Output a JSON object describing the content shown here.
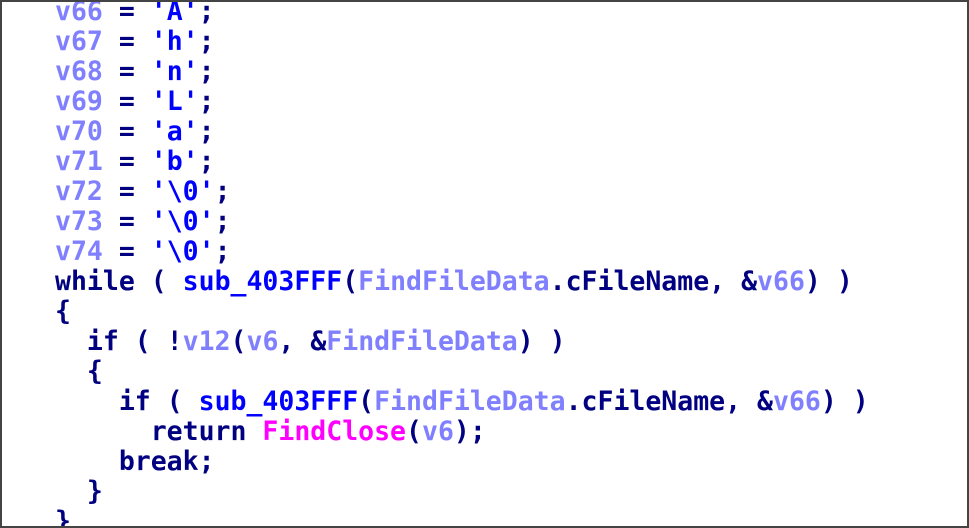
{
  "colors": {
    "keyword": "#000080",
    "punctuation": "#000080",
    "variable": "#8080ff",
    "string": "#0000ff",
    "function": "#0000ff",
    "import": "#ff00ff"
  },
  "lines": [
    [
      [
        "v66",
        "var"
      ],
      [
        " = ",
        "punc"
      ],
      [
        "'A'",
        "str"
      ],
      [
        ";",
        "punc"
      ]
    ],
    [
      [
        "v67",
        "var"
      ],
      [
        " = ",
        "punc"
      ],
      [
        "'h'",
        "str"
      ],
      [
        ";",
        "punc"
      ]
    ],
    [
      [
        "v68",
        "var"
      ],
      [
        " = ",
        "punc"
      ],
      [
        "'n'",
        "str"
      ],
      [
        ";",
        "punc"
      ]
    ],
    [
      [
        "v69",
        "var"
      ],
      [
        " = ",
        "punc"
      ],
      [
        "'L'",
        "str"
      ],
      [
        ";",
        "punc"
      ]
    ],
    [
      [
        "v70",
        "var"
      ],
      [
        " = ",
        "punc"
      ],
      [
        "'a'",
        "str"
      ],
      [
        ";",
        "punc"
      ]
    ],
    [
      [
        "v71",
        "var"
      ],
      [
        " = ",
        "punc"
      ],
      [
        "'b'",
        "str"
      ],
      [
        ";",
        "punc"
      ]
    ],
    [
      [
        "v72",
        "var"
      ],
      [
        " = ",
        "punc"
      ],
      [
        "'\\0'",
        "str"
      ],
      [
        ";",
        "punc"
      ]
    ],
    [
      [
        "v73",
        "var"
      ],
      [
        " = ",
        "punc"
      ],
      [
        "'\\0'",
        "str"
      ],
      [
        ";",
        "punc"
      ]
    ],
    [
      [
        "v74",
        "var"
      ],
      [
        " = ",
        "punc"
      ],
      [
        "'\\0'",
        "str"
      ],
      [
        ";",
        "punc"
      ]
    ],
    [
      [
        "while",
        "kw"
      ],
      [
        " ( ",
        "punc"
      ],
      [
        "sub_403FFF",
        "func"
      ],
      [
        "(",
        "punc"
      ],
      [
        "FindFileData",
        "var"
      ],
      [
        ".cFileName, &",
        "punc"
      ],
      [
        "v66",
        "var"
      ],
      [
        ") )",
        "punc"
      ]
    ],
    [
      [
        "{",
        "punc"
      ]
    ],
    [
      [
        "  if",
        "kw"
      ],
      [
        " ( !",
        "punc"
      ],
      [
        "v12",
        "var"
      ],
      [
        "(",
        "punc"
      ],
      [
        "v6",
        "var"
      ],
      [
        ", &",
        "punc"
      ],
      [
        "FindFileData",
        "var"
      ],
      [
        ") )",
        "punc"
      ]
    ],
    [
      [
        "  {",
        "punc"
      ]
    ],
    [
      [
        "    if",
        "kw"
      ],
      [
        " ( ",
        "punc"
      ],
      [
        "sub_403FFF",
        "func"
      ],
      [
        "(",
        "punc"
      ],
      [
        "FindFileData",
        "var"
      ],
      [
        ".cFileName, &",
        "punc"
      ],
      [
        "v66",
        "var"
      ],
      [
        ") )",
        "punc"
      ]
    ],
    [
      [
        "      return",
        "kw"
      ],
      [
        " ",
        "punc"
      ],
      [
        "FindClose",
        "import"
      ],
      [
        "(",
        "punc"
      ],
      [
        "v6",
        "var"
      ],
      [
        ");",
        "punc"
      ]
    ],
    [
      [
        "    break",
        "kw"
      ],
      [
        ";",
        "punc"
      ]
    ],
    [
      [
        "  }",
        "punc"
      ]
    ],
    [
      [
        "}",
        "punc"
      ]
    ]
  ]
}
